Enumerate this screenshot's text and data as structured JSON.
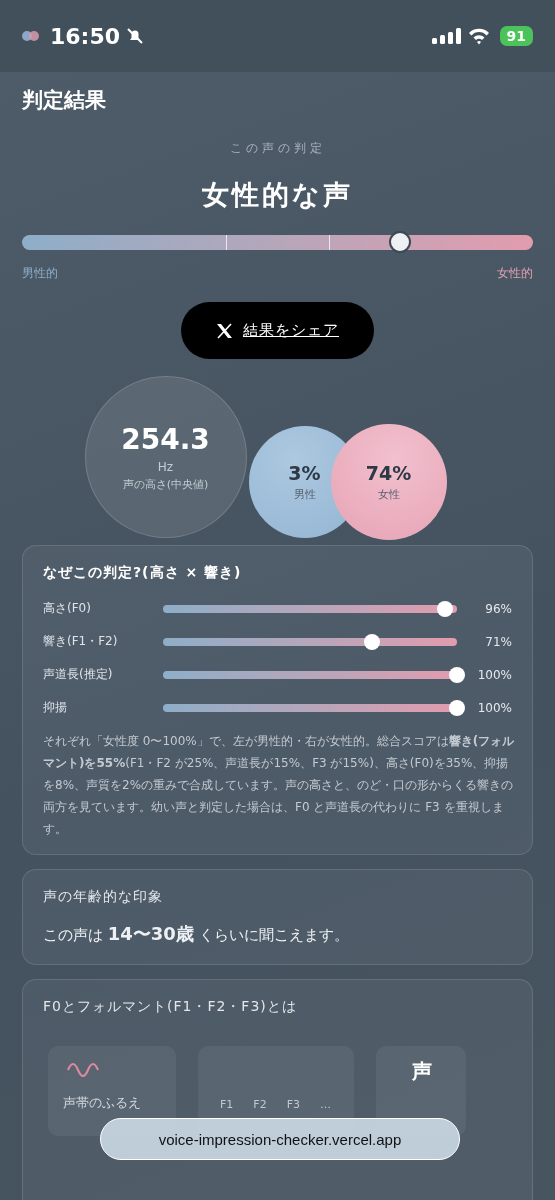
{
  "status_bar": {
    "time": "16:50",
    "battery": "91"
  },
  "page": {
    "title": "判定結果"
  },
  "verdict": {
    "caption": "この声の判定",
    "label": "女性的な声",
    "level": 0.74,
    "left_label": "男性的",
    "right_label": "女性的"
  },
  "share_button": {
    "label": "結果をシェア"
  },
  "stats": [
    {
      "kind": "pitch",
      "value": "254.3",
      "unit": "Hz",
      "label": "声の高さ(中央値)"
    },
    {
      "kind": "male",
      "value": "3%",
      "label": "男性"
    },
    {
      "kind": "female",
      "value": "74%",
      "label": "女性"
    }
  ],
  "reason_card": {
    "title": "なぜこの判定?(高さ × 響き)",
    "factors": [
      {
        "name": "高さ(F0)",
        "level": 0.96,
        "reading": "96%"
      },
      {
        "name": "響き(F1・F2)",
        "level": 0.71,
        "reading": "71%"
      },
      {
        "name": "声道長(推定)",
        "level": 1,
        "reading": "100%"
      },
      {
        "name": "抑揚",
        "level": 1,
        "reading": "100%"
      }
    ],
    "note": "それぞれ「女性度 0〜100%」で、左が男性的・右が女性的。総合スコアは**響き(フォルマント)を55%**(F1・F2 が25%、声道長が15%、F3 が15%)、高さ(F0)を35%、抑揚を8%、声質を2%の重みで合成しています。声の高さと、のど・口の形からくる響きの両方を見ています。幼い声と判定した場合は、F0 と声道長の代わりに F3 を重視します。"
  },
  "age_card": {
    "title": "声の年齢的な印象",
    "text": "この声は **14〜30歳** くらいに聞こえます。"
  },
  "formant_card": {
    "title": "F0とフォルマント(F1・F2・F3)とは",
    "tiles": [
      {
        "kind": "wave",
        "label": "声帯のふるえ"
      },
      {
        "kind": "formants",
        "labels": [
          "F1",
          "F2",
          "F3",
          "…"
        ]
      },
      {
        "kind": "text",
        "label": "声"
      }
    ]
  },
  "url_bar": {
    "url": "voice-impression-checker.vercel.app"
  }
}
